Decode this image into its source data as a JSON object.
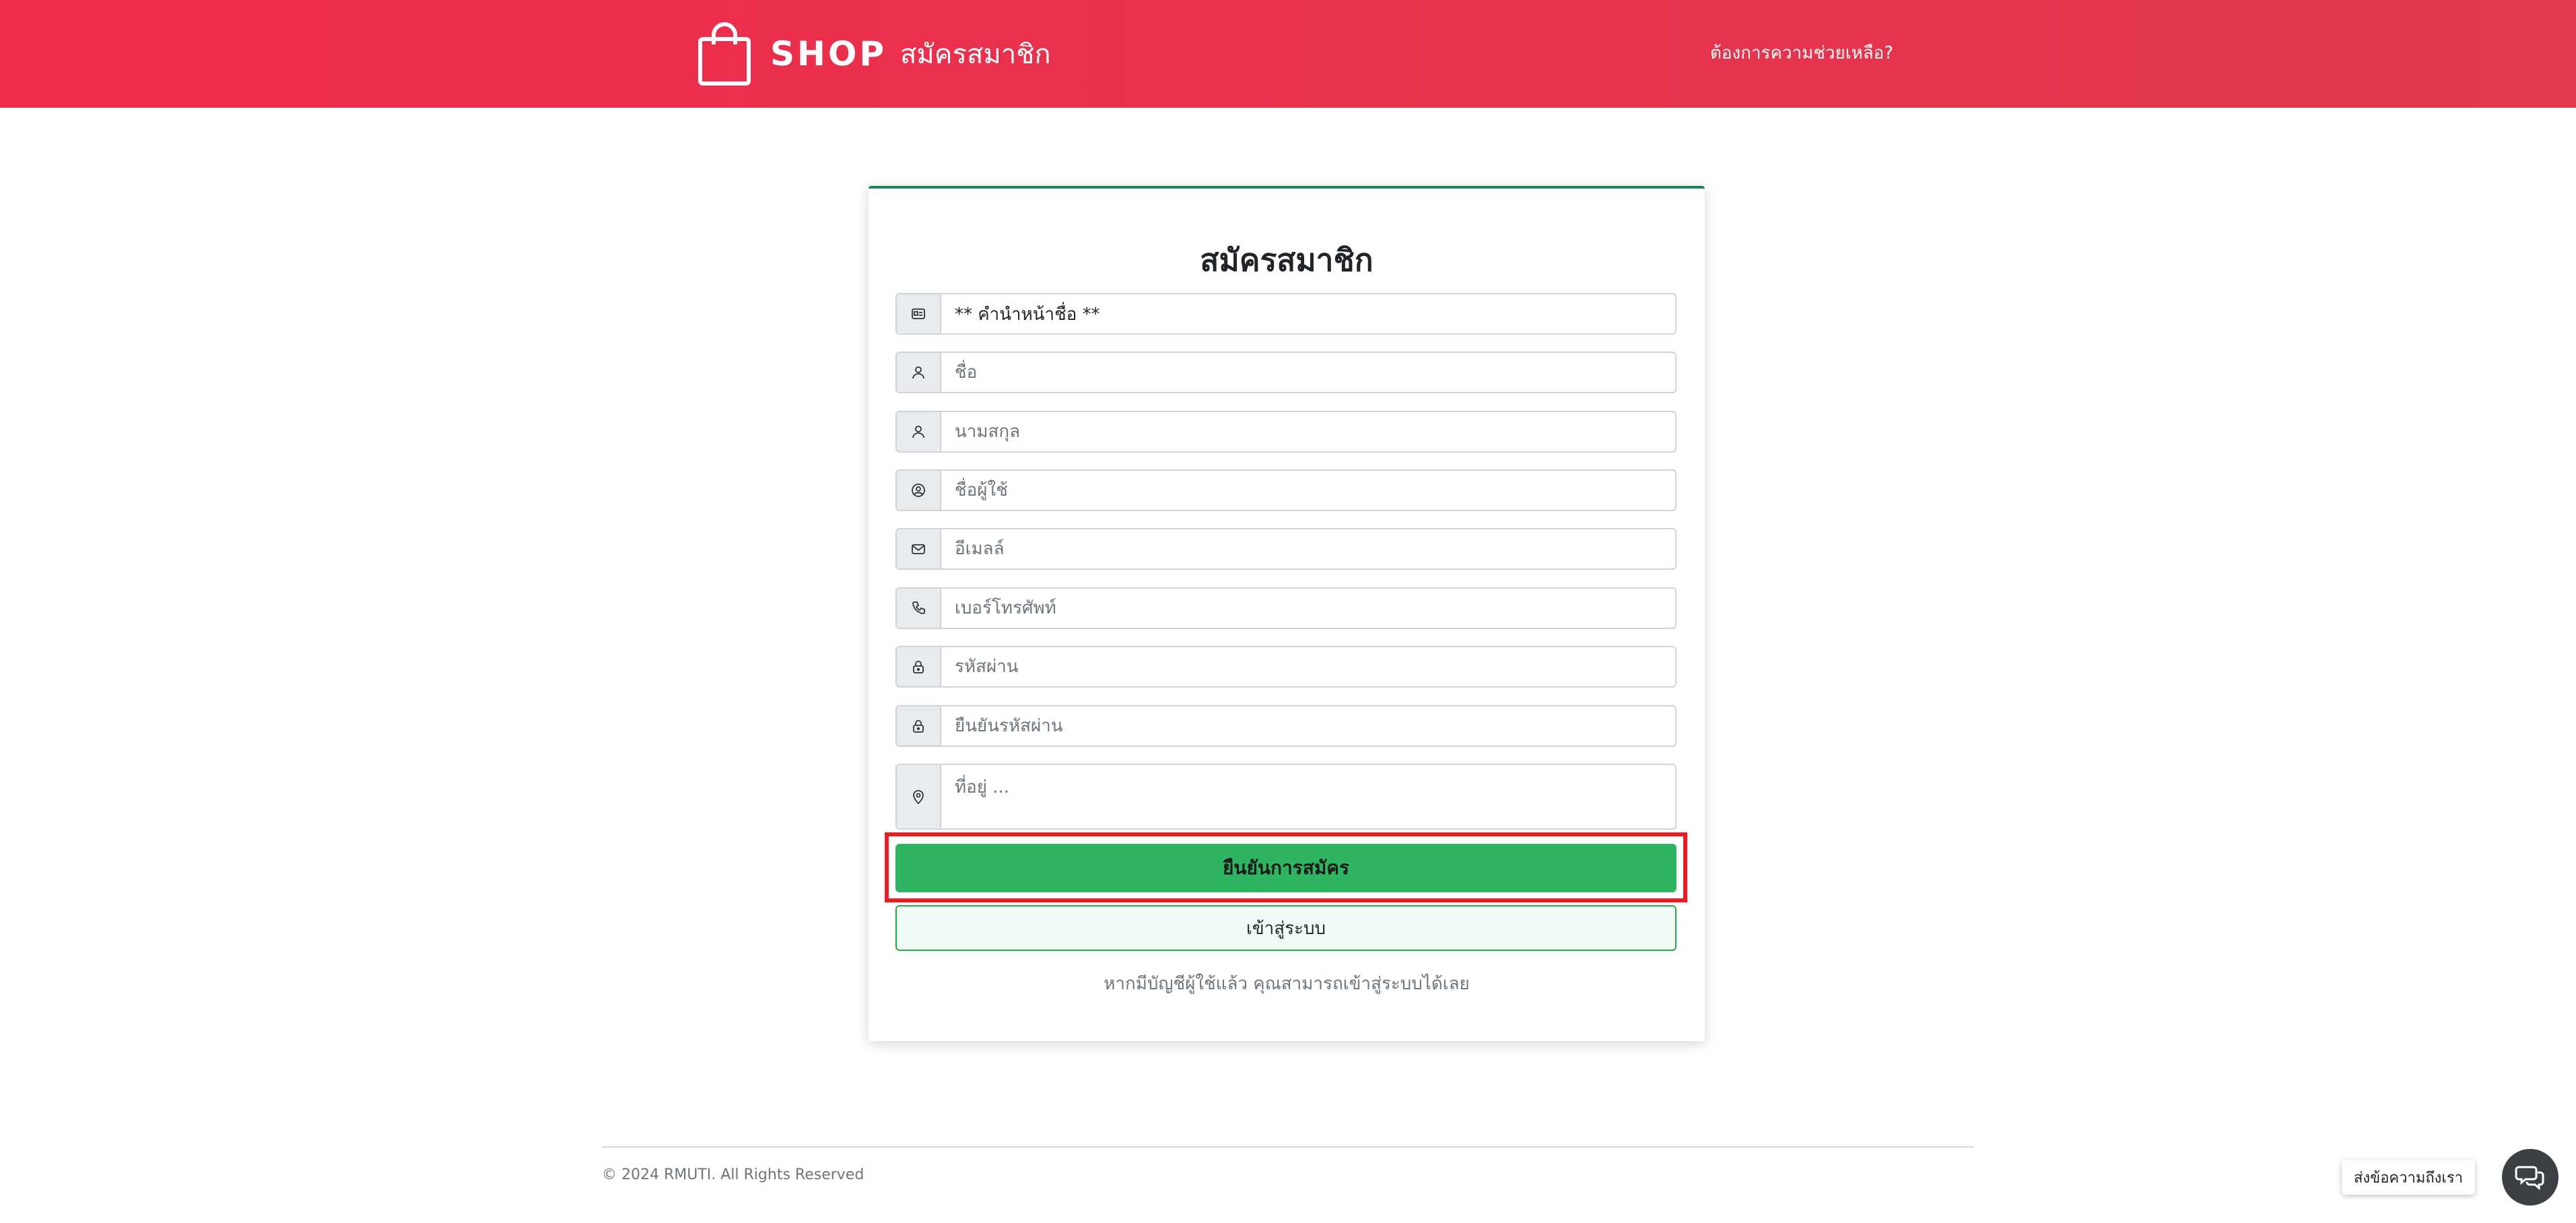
{
  "header": {
    "brand_text": "SHOP",
    "brand_subtitle": "สมัครสมาชิก",
    "help_link": "ต้องการความช่วยเหลือ?"
  },
  "form": {
    "title": "สมัครสมาชิก",
    "prefix_select": "** คำนำหน้าชื่อ **",
    "first_name_placeholder": "ชื่อ",
    "last_name_placeholder": "นามสกุล",
    "username_placeholder": "ชื่อผู้ใช้",
    "email_placeholder": "อีเมลล์",
    "phone_placeholder": "เบอร์โทรศัพท์",
    "password_placeholder": "รหัสผ่าน",
    "confirm_password_placeholder": "ยืนยันรหัสผ่าน",
    "address_placeholder": "ที่อยู่ ...",
    "submit_label": "ยืนยันการสมัคร",
    "login_label": "เข้าสู่ระบบ",
    "hint": "หากมีบัญชีผู้ใช้แล้ว คุณสามารถเข้าสู่ระบบได้เลย"
  },
  "footer": {
    "copyright": "© 2024 RMUTI. All Rights Reserved"
  },
  "chat": {
    "label": "ส่งข้อความถึงเรา"
  },
  "colors": {
    "header_start": "#ef2b4c",
    "header_end": "#e0384d",
    "submit_green": "#2fb562",
    "highlight_red": "#ec1c24"
  }
}
